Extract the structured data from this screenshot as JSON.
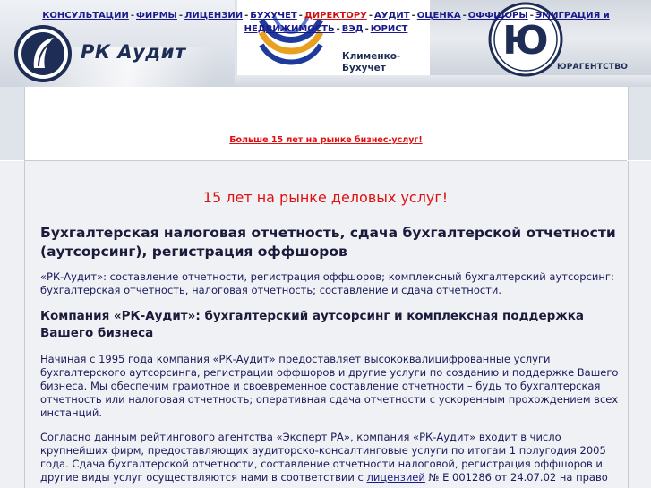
{
  "header": {
    "brand_rk": "РК Аудит",
    "brand_kb_line1": "Клименко-",
    "brand_kb_line2": "Бухучет",
    "brand_ua": "ЮРАГЕНТСТВО"
  },
  "nav": {
    "items": [
      {
        "label": "КОНСУЛЬТАЦИИ"
      },
      {
        "label": "ФИРМЫ"
      },
      {
        "label": "ЛИЦЕНЗИИ"
      },
      {
        "label": "БУХУЧЕТ"
      },
      {
        "label": "ДИРЕКТОРУ",
        "highlight": true
      },
      {
        "label": "АУДИТ"
      },
      {
        "label": "ОЦЕНКА"
      },
      {
        "label": "ОФФШОРЫ"
      },
      {
        "label": "ЭМИГРАЦИЯ и НЕДВИЖИМОСТЬ"
      },
      {
        "label": "ВЭД"
      },
      {
        "label": "ЮРИСТ"
      }
    ],
    "separator": "-",
    "promo": "Больше 15 лет на рынке бизнес-услуг!"
  },
  "content": {
    "slogan": "15 лет на рынке деловых услуг!",
    "title": "Бухгалтерская налоговая отчетность, сдача бухгалтерской отчетности (аутсорсинг), регистрация оффшоров",
    "intro": "«РК-Аудит»: составление отчетности,  регистрация оффшоров; комплексный бухгалтерский аутсорсинг: бухгалтерская отчетность, налоговая отчетность; составление и сдача отчетности.",
    "subtitle": "Компания «РК-Аудит»: бухгалтерский аутсорсинг и комплексная поддержка Вашего бизнеса",
    "para1": "Начиная с   1995 года компания  «РК-Аудит» предоставляет высококвалицифрованные услуги бухгалтерского аутсорсинга, регистрации оффшоров и другие услуги по созданию и поддержке Вашего бизнеса. Мы обеспечим грамотное и своевременное составление отчетности  – будь то бухгалтерская отчетность или налоговая отчетность; оперативная сдача отчетности с ускоренным прохождением всех инстанций.",
    "para2_before": "Согласно данным рейтингового агентства  «Эксперт РА», компания  «РК-Аудит» входит в число крупнейших фирм, предоставляющих аудиторско-консалтинговые услуги по итогам  1 полугодия  2005 года. Сдача бухгалтерской отчетности, составление отчетности налоговой, регистрация оффшоров и другие виды услуг осуществляются нами в соответствии с ",
    "para2_link": "лицензией",
    "para2_after": " № Е 001286 от 24.07.02 на право"
  },
  "colors": {
    "link": "#1a1a8a",
    "accent_red": "#e01010",
    "header_bg": "#dfe3ea",
    "brand_navy": "#1d2d55"
  }
}
